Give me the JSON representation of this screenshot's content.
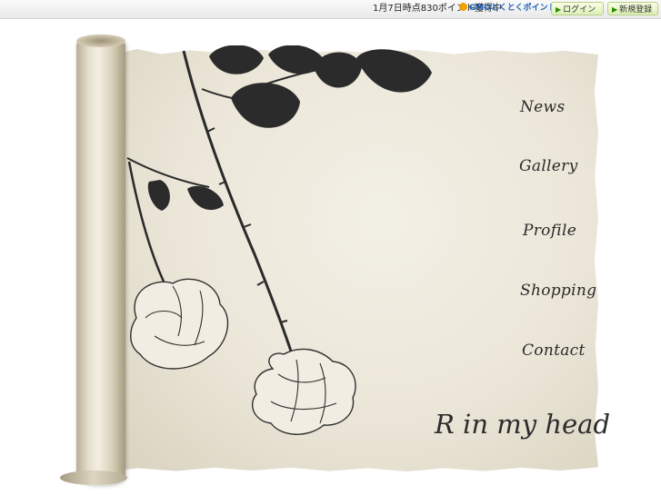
{
  "topbar": {
    "points_text": "1月7日時点830ポイント獲得中",
    "gmo_badge": "GMOとくとくポイント",
    "login_label": "ログイン",
    "register_label": "新規登録"
  },
  "nav": {
    "news": "News",
    "gallery": "Gallery",
    "profile": "Profile",
    "shopping": "Shopping",
    "contact": "Contact"
  },
  "logo": "R in my head",
  "colors": {
    "paper": "#ebe6d8",
    "ink": "#2a2a2a",
    "button_green": "#dcefb5"
  }
}
